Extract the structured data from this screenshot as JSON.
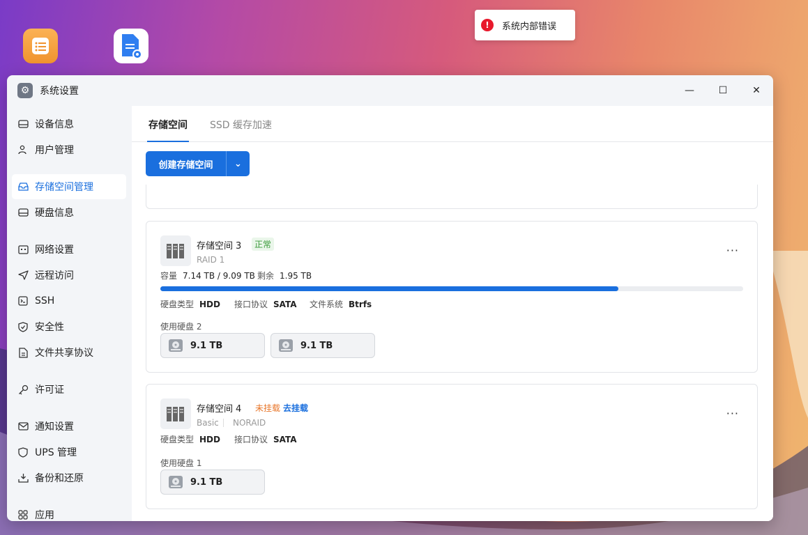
{
  "toast": {
    "message": "系统内部错误",
    "icon": "error-icon"
  },
  "window": {
    "title": "系统设置"
  },
  "sidebar": {
    "items": [
      {
        "label": "设备信息",
        "icon": "hard-drive-icon"
      },
      {
        "label": "用户管理",
        "icon": "users-icon"
      },
      {
        "label": "存储空间管理",
        "icon": "storage-icon",
        "active": true
      },
      {
        "label": "硬盘信息",
        "icon": "disk-icon"
      },
      {
        "label": "网络设置",
        "icon": "network-icon"
      },
      {
        "label": "远程访问",
        "icon": "send-icon"
      },
      {
        "label": "SSH",
        "icon": "terminal-icon"
      },
      {
        "label": "安全性",
        "icon": "shield-check-icon"
      },
      {
        "label": "文件共享协议",
        "icon": "file-icon"
      },
      {
        "label": "许可证",
        "icon": "key-icon"
      },
      {
        "label": "通知设置",
        "icon": "mail-icon"
      },
      {
        "label": "UPS 管理",
        "icon": "shield-icon"
      },
      {
        "label": "备份和还原",
        "icon": "backup-icon"
      },
      {
        "label": "应用",
        "icon": "apps-icon"
      }
    ]
  },
  "tabs": [
    {
      "label": "存储空间"
    },
    {
      "label": "SSD 缓存加速"
    }
  ],
  "create_button": {
    "label": "创建存储空间"
  },
  "pools": [
    {
      "name": "存储空间",
      "index": "3",
      "status": "正常",
      "raid": "RAID 1",
      "capacity_label": "容量",
      "capacity": "7.14 TB / 9.09 TB",
      "remaining_label": "剩余",
      "remaining": "1.95 TB",
      "usage_fraction": 0.786,
      "disk_type_label": "硬盘类型",
      "disk_type": "HDD",
      "interface_label": "接口协议",
      "interface": "SATA",
      "fs_label": "文件系统",
      "fs": "Btrfs",
      "used_disks_label": "使用硬盘",
      "used_disks_count": "2",
      "disks": [
        "9.1 TB",
        "9.1 TB"
      ]
    },
    {
      "name": "存储空间",
      "index": "4",
      "status": "未挂载",
      "action": "去挂载",
      "raid": "Basic",
      "mode": "NORAID",
      "disk_type_label": "硬盘类型",
      "disk_type": "HDD",
      "interface_label": "接口协议",
      "interface": "SATA",
      "used_disks_label": "使用硬盘",
      "used_disks_count": "1",
      "disks": [
        "9.1 TB"
      ]
    }
  ],
  "colors": {
    "accent": "#1a6fde",
    "ok": "#3a9b3a",
    "warn": "#e8762a",
    "error": "#e8192c"
  }
}
